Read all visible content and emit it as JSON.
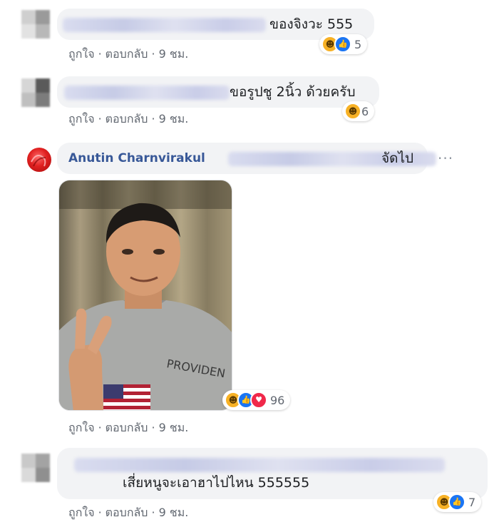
{
  "comments": [
    {
      "text": "ของจิงวะ 555",
      "actions": {
        "like": "ถูกใจ",
        "reply": "ตอบกลับ",
        "time": "9 ชม."
      },
      "reaction_count": "5"
    },
    {
      "text": "ขอรูปชู 2นิ้ว ด้วยครับ",
      "actions": {
        "like": "ถูกใจ",
        "reply": "ตอบกลับ",
        "time": "9 ชม."
      },
      "reaction_count": "6"
    },
    {
      "author": "Anutin Charnvirakul",
      "text": "จัดไป",
      "more_label": "···",
      "actions": {
        "like": "ถูกใจ",
        "reply": "ตอบกลับ",
        "time": "9 ชม."
      },
      "reaction_count": "96"
    },
    {
      "text": "เสี่ยหนูจะเอาฮาไปไหน 555555",
      "actions": {
        "like": "ถูกใจ",
        "reply": "ตอบกลับ",
        "time": "9 ชม."
      },
      "reaction_count": "7"
    }
  ],
  "separator": "·",
  "icons": {
    "haha": "haha-reaction-icon",
    "like": "like-reaction-icon",
    "love": "love-reaction-icon",
    "more": "more-options-icon"
  },
  "colors": {
    "author": "#385898",
    "bubble": "#f2f3f5",
    "like": "#1a75f4",
    "haha": "#f7b125",
    "love": "#f0284a"
  }
}
